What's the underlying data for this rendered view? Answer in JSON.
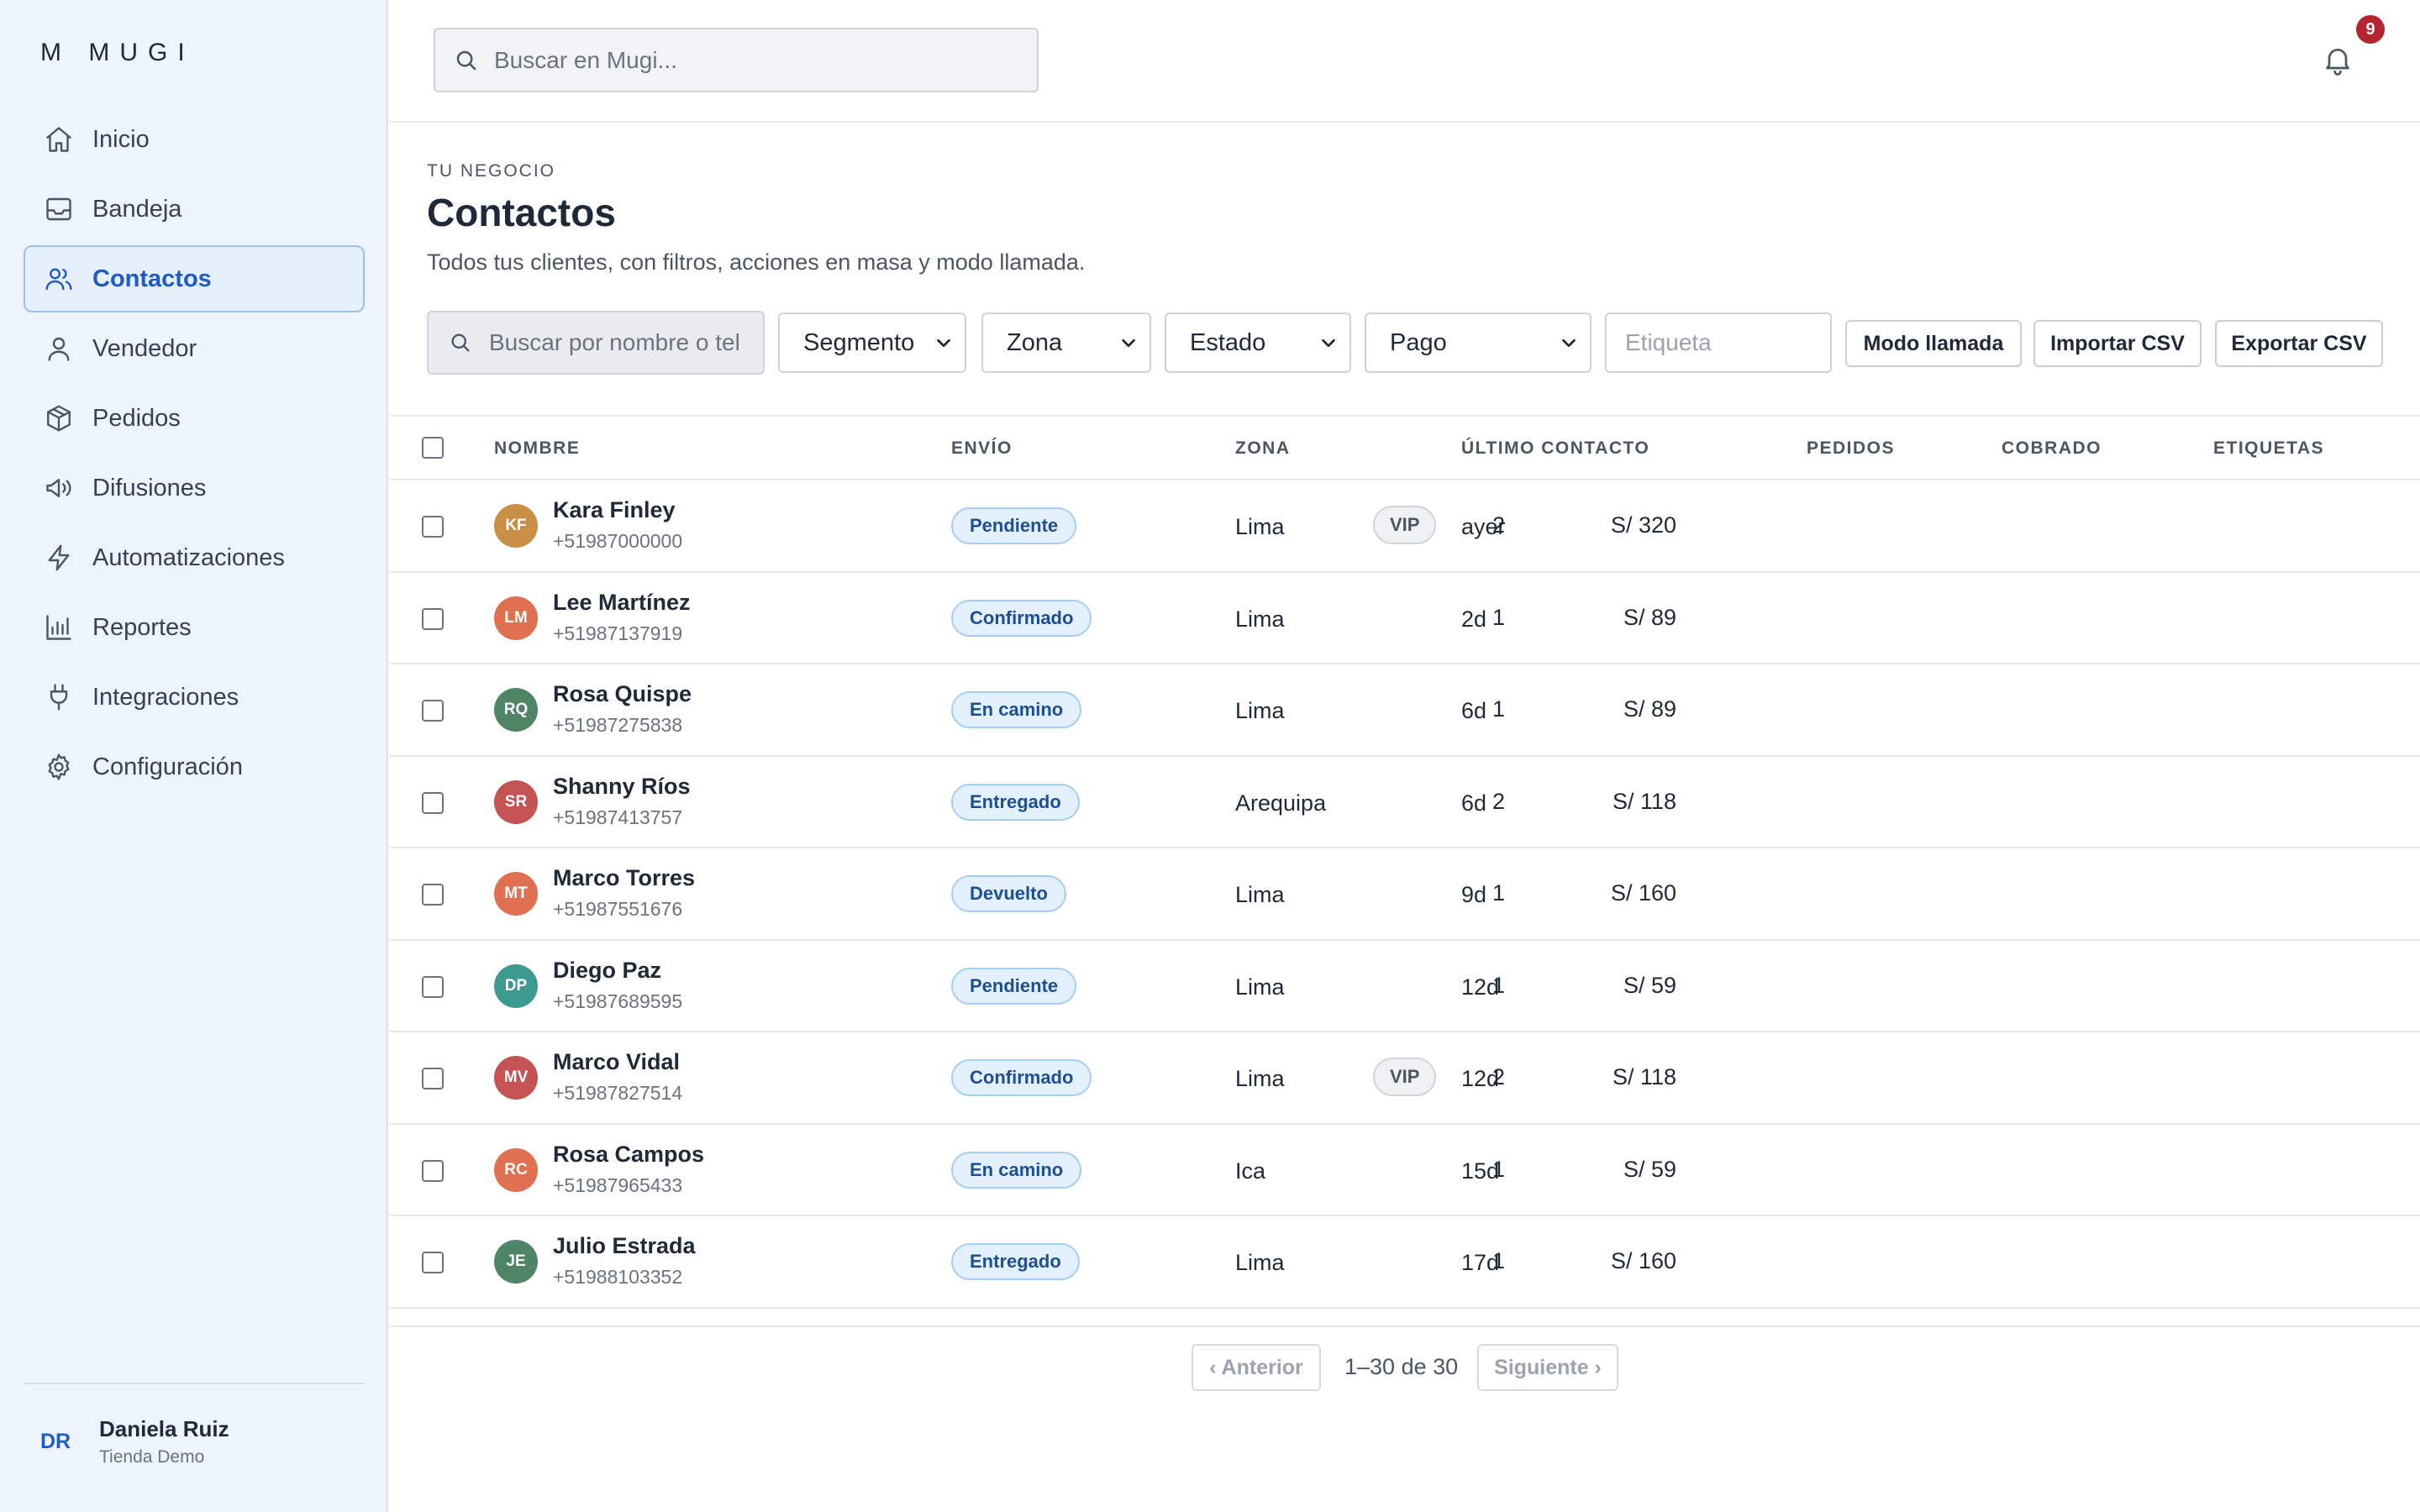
{
  "app": {
    "logo": "M MUGI"
  },
  "sidebar": {
    "items": [
      {
        "label": "Inicio",
        "icon": "home-icon"
      },
      {
        "label": "Bandeja",
        "icon": "inbox-icon"
      },
      {
        "label": "Contactos",
        "icon": "users-icon",
        "active": true
      },
      {
        "label": "Vendedor",
        "icon": "user-icon"
      },
      {
        "label": "Pedidos",
        "icon": "package-icon"
      },
      {
        "label": "Difusiones",
        "icon": "megaphone-icon"
      },
      {
        "label": "Automatizaciones",
        "icon": "bolt-icon"
      },
      {
        "label": "Reportes",
        "icon": "bar-chart-icon"
      },
      {
        "label": "Integraciones",
        "icon": "plug-icon"
      },
      {
        "label": "Configuración",
        "icon": "gear-icon"
      }
    ],
    "user": {
      "initials": "DR",
      "name": "Daniela Ruiz",
      "store": "Tienda Demo"
    }
  },
  "topbar": {
    "search_placeholder": "Buscar en Mugi...",
    "notifications_count": "9"
  },
  "page": {
    "kicker": "TU NEGOCIO",
    "title": "Contactos",
    "description": "Todos tus clientes, con filtros, acciones en masa y modo llamada."
  },
  "filters": {
    "search_placeholder": "Buscar por nombre o teléfono",
    "segment": "Segmento",
    "zone": "Zona",
    "status": "Estado",
    "payment": "Pago",
    "tag_placeholder": "Etiqueta",
    "call_mode_button": "Modo llamada",
    "import_button": "Importar CSV",
    "export_button": "Exportar CSV"
  },
  "table": {
    "columns": {
      "name": "NOMBRE",
      "shipping": "ENVÍO",
      "zone": "ZONA",
      "last_contact": "ÚLTIMO CONTACTO",
      "orders": "PEDIDOS",
      "collected": "COBRADO",
      "tags": "ETIQUETAS"
    },
    "rows": [
      {
        "initials": "KF",
        "name": "Kara Finley",
        "phone": "+51987000000",
        "shipping": "Pendiente",
        "zone": "Lima",
        "last_contact": "ayer",
        "orders": "2",
        "collected": "S/ 320",
        "tag": "VIP",
        "avatar_color": "#c98f47"
      },
      {
        "initials": "LM",
        "name": "Lee Martínez",
        "phone": "+51987137919",
        "shipping": "Confirmado",
        "zone": "Lima",
        "last_contact": "2d",
        "orders": "1",
        "collected": "S/ 89",
        "tag": "",
        "avatar_color": "#df7050"
      },
      {
        "initials": "RQ",
        "name": "Rosa Quispe",
        "phone": "+51987275838",
        "shipping": "En camino",
        "zone": "Lima",
        "last_contact": "6d",
        "orders": "1",
        "collected": "S/ 89",
        "tag": "",
        "avatar_color": "#4f8466"
      },
      {
        "initials": "SR",
        "name": "Shanny Ríos",
        "phone": "+51987413757",
        "shipping": "Entregado",
        "zone": "Arequipa",
        "last_contact": "6d",
        "orders": "2",
        "collected": "S/ 118",
        "tag": "",
        "avatar_color": "#c55353"
      },
      {
        "initials": "MT",
        "name": "Marco Torres",
        "phone": "+51987551676",
        "shipping": "Devuelto",
        "zone": "Lima",
        "last_contact": "9d",
        "orders": "1",
        "collected": "S/ 160",
        "tag": "",
        "avatar_color": "#df7050"
      },
      {
        "initials": "DP",
        "name": "Diego Paz",
        "phone": "+51987689595",
        "shipping": "Pendiente",
        "zone": "Lima",
        "last_contact": "12d",
        "orders": "1",
        "collected": "S/ 59",
        "tag": "",
        "avatar_color": "#3d9a8e"
      },
      {
        "initials": "MV",
        "name": "Marco Vidal",
        "phone": "+51987827514",
        "shipping": "Confirmado",
        "zone": "Lima",
        "last_contact": "12d",
        "orders": "2",
        "collected": "S/ 118",
        "tag": "VIP",
        "avatar_color": "#c55353"
      },
      {
        "initials": "RC",
        "name": "Rosa Campos",
        "phone": "+51987965433",
        "shipping": "En camino",
        "zone": "Ica",
        "last_contact": "15d",
        "orders": "1",
        "collected": "S/ 59",
        "tag": "",
        "avatar_color": "#df7050"
      },
      {
        "initials": "JE",
        "name": "Julio Estrada",
        "phone": "+51988103352",
        "shipping": "Entregado",
        "zone": "Lima",
        "last_contact": "17d",
        "orders": "1",
        "collected": "S/ 160",
        "tag": "",
        "avatar_color": "#4f8466"
      }
    ]
  },
  "pagination": {
    "prev": "‹ Anterior",
    "info": "1–30 de 30",
    "next": "Siguiente ›"
  }
}
